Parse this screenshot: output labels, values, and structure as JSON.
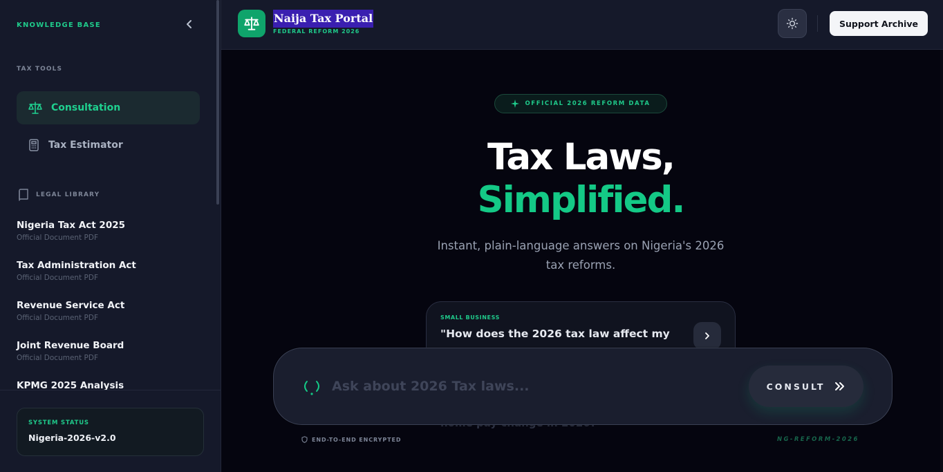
{
  "sidebar": {
    "heading": "KNOWLEDGE BASE",
    "collapse_icon": "chevron-left-icon",
    "tools_label": "TAX TOOLS",
    "tools": [
      {
        "label": "Consultation",
        "icon": "scales-icon",
        "active": true
      },
      {
        "label": "Tax Estimator",
        "icon": "calculator-icon",
        "active": false
      }
    ],
    "library_label": "LEGAL LIBRARY",
    "library_icon": "book-icon",
    "documents": [
      {
        "title": "Nigeria Tax Act 2025",
        "subtitle": "Official Document PDF"
      },
      {
        "title": "Tax Administration Act",
        "subtitle": "Official Document PDF"
      },
      {
        "title": "Revenue Service Act",
        "subtitle": "Official Document PDF"
      },
      {
        "title": "Joint Revenue Board",
        "subtitle": "Official Document PDF"
      },
      {
        "title": "KPMG 2025 Analysis",
        "subtitle": ""
      }
    ],
    "status": {
      "label": "SYSTEM STATUS",
      "value": "Nigeria-2026-v2.0"
    }
  },
  "header": {
    "logo_icon": "scales-icon",
    "title": "Naija Tax Portal",
    "subtitle": "FEDERAL REFORM 2026",
    "theme_icon": "sun-icon",
    "support_label": "Support Archive"
  },
  "hero": {
    "badge": "OFFICIAL 2026 REFORM DATA",
    "badge_icon": "sparkle-icon",
    "title_line1": "Tax Laws,",
    "title_line2": "Simplified.",
    "tagline": "Instant, plain-language answers on Nigeria's 2026 tax reforms."
  },
  "suggestion": {
    "category": "SMALL BUSINESS",
    "question": "\"How does the 2026 tax law affect my small provisions shop?\"",
    "arrow_icon": "chevron-right-icon"
  },
  "peek_text": "home pay change in 2026?",
  "ask": {
    "placeholder": "Ask about 2026 Tax laws...",
    "mic_icon": "broadcast-icon",
    "button_label": "CONSULT",
    "button_icon": "double-chevron-right-icon"
  },
  "footer": {
    "encrypted": "END-TO-END ENCRYPTED",
    "version_tag": "NG-REFORM-2026"
  },
  "colors": {
    "accent": "#14c986",
    "background": "#05050f",
    "sidebar": "#15192a"
  }
}
